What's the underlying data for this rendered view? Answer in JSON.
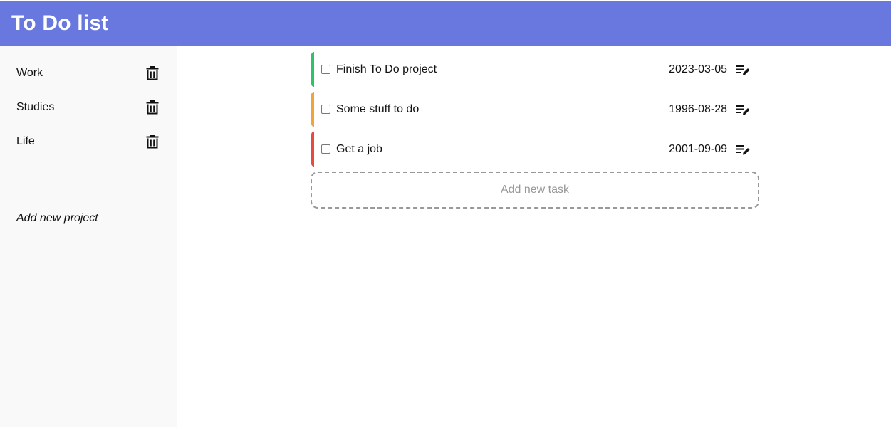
{
  "header": {
    "title": "To Do list"
  },
  "sidebar": {
    "projects": [
      {
        "label": "Work",
        "icon": "trash-icon"
      },
      {
        "label": "Studies",
        "icon": "trash-icon"
      },
      {
        "label": "Life",
        "icon": "trash-icon"
      }
    ],
    "add_project_label": "Add new project"
  },
  "tasks": [
    {
      "title": "Finish To Do project",
      "date": "2023-03-05",
      "priority_color": "#2cc36b",
      "completed": false,
      "icon": "edit-icon"
    },
    {
      "title": "Some stuff to do",
      "date": "1996-08-28",
      "priority_color": "#f0a43a",
      "completed": false,
      "icon": "edit-icon"
    },
    {
      "title": "Get a job",
      "date": "2001-09-09",
      "priority_color": "#e84a3f",
      "completed": false,
      "icon": "edit-icon"
    }
  ],
  "add_task_label": "Add new task",
  "colors": {
    "header_bg": "#6878de",
    "sidebar_bg": "#f9f9f9"
  }
}
